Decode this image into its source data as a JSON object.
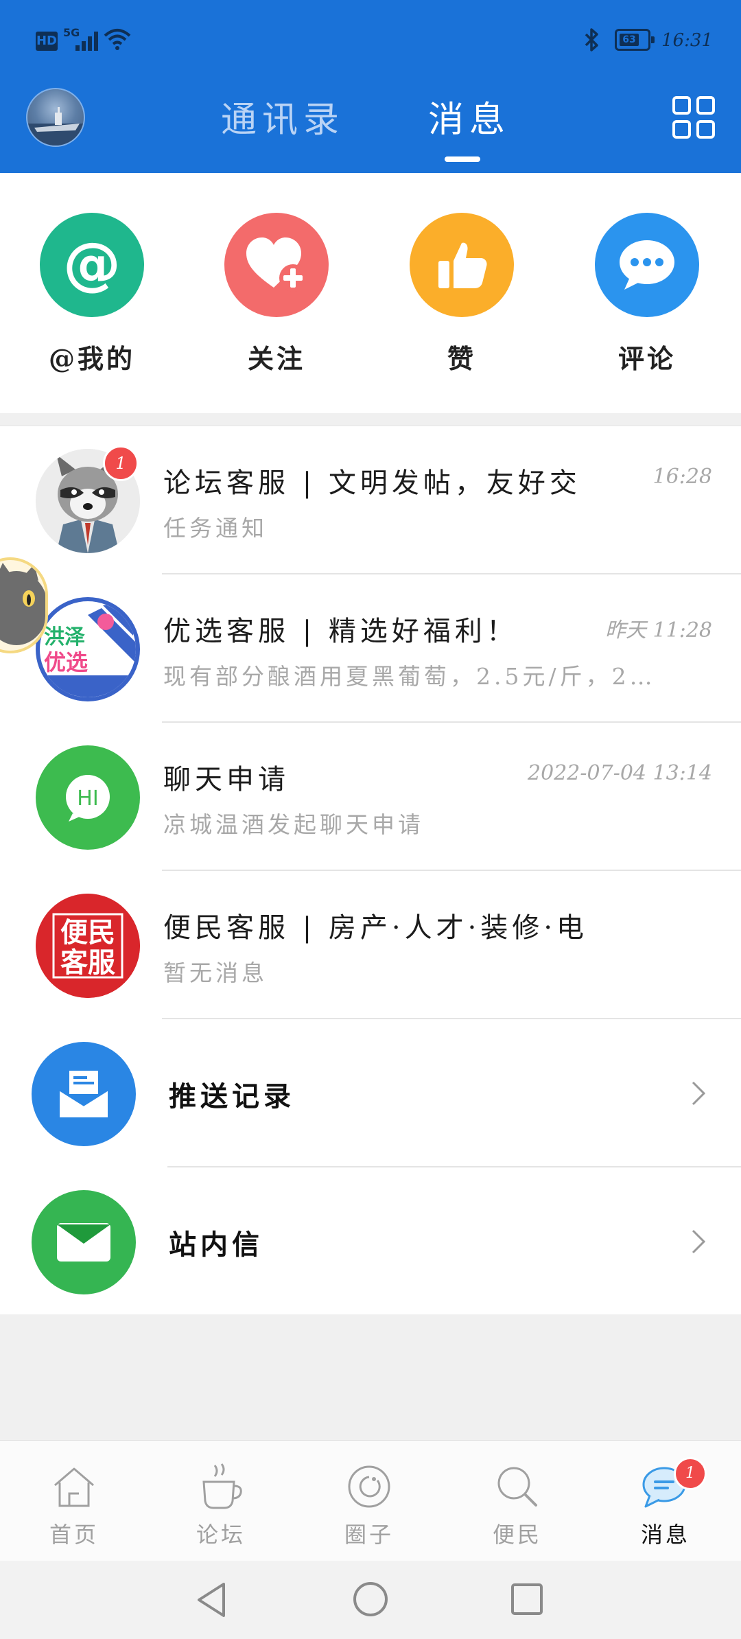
{
  "status_bar": {
    "hd": "HD",
    "network": "5G",
    "battery": "63",
    "time": "16:31"
  },
  "header": {
    "tabs": [
      {
        "label": "通讯录",
        "active": false
      },
      {
        "label": "消息",
        "active": true
      }
    ]
  },
  "quick_actions": [
    {
      "label": "@我的",
      "icon": "at-icon",
      "color": "#1fb78d"
    },
    {
      "label": "关注",
      "icon": "heart-plus-icon",
      "color": "#f36b6b"
    },
    {
      "label": "赞",
      "icon": "thumbs-up-icon",
      "color": "#fbae2a"
    },
    {
      "label": "评论",
      "icon": "comment-icon",
      "color": "#2b94ee"
    }
  ],
  "messages": [
    {
      "title": "论坛客服 | 文明发帖，友好交",
      "subtitle": "任务通知",
      "time": "16:28",
      "badge": "1"
    },
    {
      "title": "优选客服 | 精选好福利！",
      "subtitle": "现有部分酿酒用夏黑葡萄，2.5元/斤，2…",
      "time": "昨天 11:28",
      "avatar_text": [
        "洪泽",
        "优选"
      ]
    },
    {
      "title": "聊天申请",
      "subtitle": "凉城温酒发起聊天申请",
      "time": "2022-07-04 13:14",
      "avatar_text": "HI"
    },
    {
      "title": "便民客服 | 房产·人才·装修·电话大",
      "subtitle": "暂无消息",
      "time": "",
      "avatar_text": [
        "便民",
        "客服"
      ]
    }
  ],
  "links": [
    {
      "label": "推送记录",
      "icon": "push-record-icon",
      "color": "#2a86e4"
    },
    {
      "label": "站内信",
      "icon": "mail-icon",
      "color": "#35b552"
    }
  ],
  "bottom_nav": [
    {
      "label": "首页",
      "icon": "home-icon",
      "active": false
    },
    {
      "label": "论坛",
      "icon": "coffee-icon",
      "active": false
    },
    {
      "label": "圈子",
      "icon": "circle-icon",
      "active": false
    },
    {
      "label": "便民",
      "icon": "search-icon",
      "active": false
    },
    {
      "label": "消息",
      "icon": "message-icon",
      "active": true,
      "badge": "1"
    }
  ],
  "colors": {
    "header_blue": "#1a72d8",
    "badge_red": "#f04a4a"
  }
}
